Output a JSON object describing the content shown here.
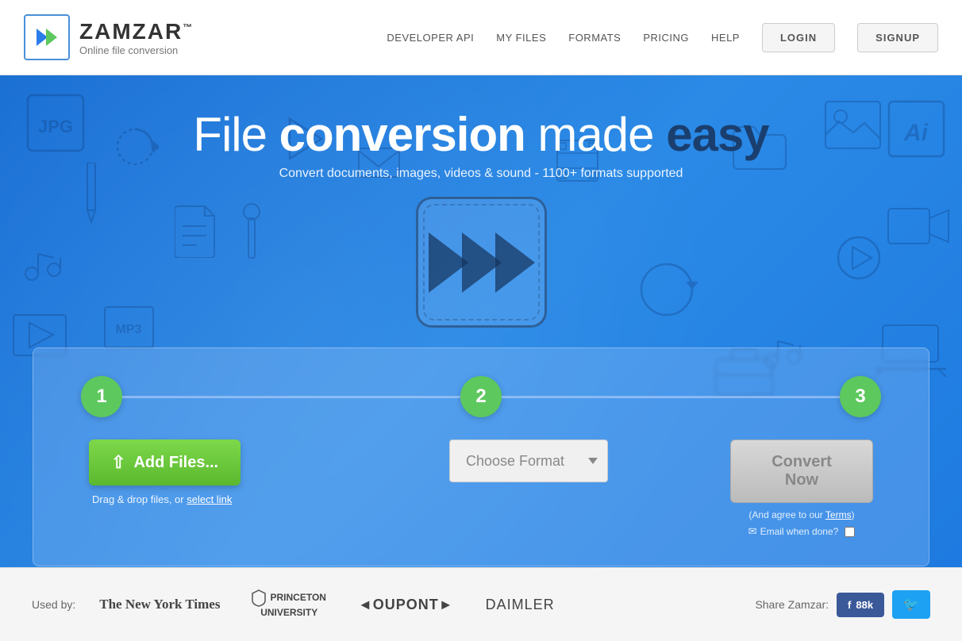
{
  "header": {
    "logo_name": "ZAMZAR",
    "logo_tm": "™",
    "logo_sub": "Online file conversion",
    "nav_links": [
      {
        "label": "DEVELOPER API",
        "id": "developer-api"
      },
      {
        "label": "MY FILES",
        "id": "my-files"
      },
      {
        "label": "FORMATS",
        "id": "formats"
      },
      {
        "label": "PRICING",
        "id": "pricing"
      },
      {
        "label": "HELP",
        "id": "help"
      }
    ],
    "login_label": "LOGIN",
    "signup_label": "SIGNUP"
  },
  "hero": {
    "title_normal": "File ",
    "title_bold": "conversion",
    "title_after": " made ",
    "title_dark": "easy",
    "subtitle": "Convert documents, images, videos & sound - 1100+ formats supported"
  },
  "conversion": {
    "step1_num": "1",
    "step2_num": "2",
    "step3_num": "3",
    "add_files_label": "Add Files...",
    "drag_drop_text": "Drag & drop files, or",
    "select_link_text": "select link",
    "choose_format_label": "Choose Format",
    "convert_now_label": "Convert Now",
    "terms_text": "(And agree to our",
    "terms_link": "Terms",
    "terms_end": ")",
    "email_label": "✉ Email when done?",
    "upload_icon": "↑"
  },
  "footer": {
    "used_by_label": "Used by:",
    "brands": [
      {
        "label": "The New York Times",
        "style": "nyt"
      },
      {
        "label": "PRINCETON\nUNIVERSITY",
        "style": "princeton"
      },
      {
        "label": "◄OUPONT►",
        "style": "dupont"
      },
      {
        "label": "DAIMLER",
        "style": "daimler"
      }
    ],
    "share_label": "Share Zamzar:",
    "fb_label": "f  88k",
    "tw_label": "🐦"
  }
}
